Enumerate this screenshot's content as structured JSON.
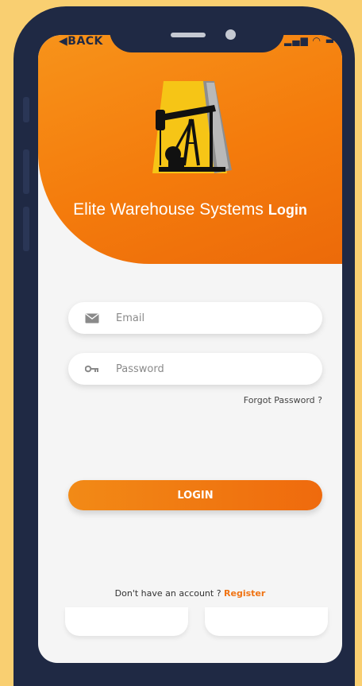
{
  "statusbar": {
    "back_label": "BACK",
    "signal_icons": "▂▄▆ ◠ ▬"
  },
  "header": {
    "brand_name": "Elite Warehouse Systems",
    "brand_login": "Login",
    "logo_icon": "oil-pump-logo"
  },
  "form": {
    "email_placeholder": "Email",
    "password_placeholder": "Password",
    "email_icon": "mail-icon",
    "password_icon": "key-icon",
    "forgot_label": "Forgot Password ?",
    "login_label": "LOGIN"
  },
  "footer": {
    "no_account_text": "Don't have an account ?",
    "register_label": "Register"
  },
  "colors": {
    "accent": "#f47b0c",
    "background": "#f9cf71",
    "phone_frame": "#1f2944"
  }
}
